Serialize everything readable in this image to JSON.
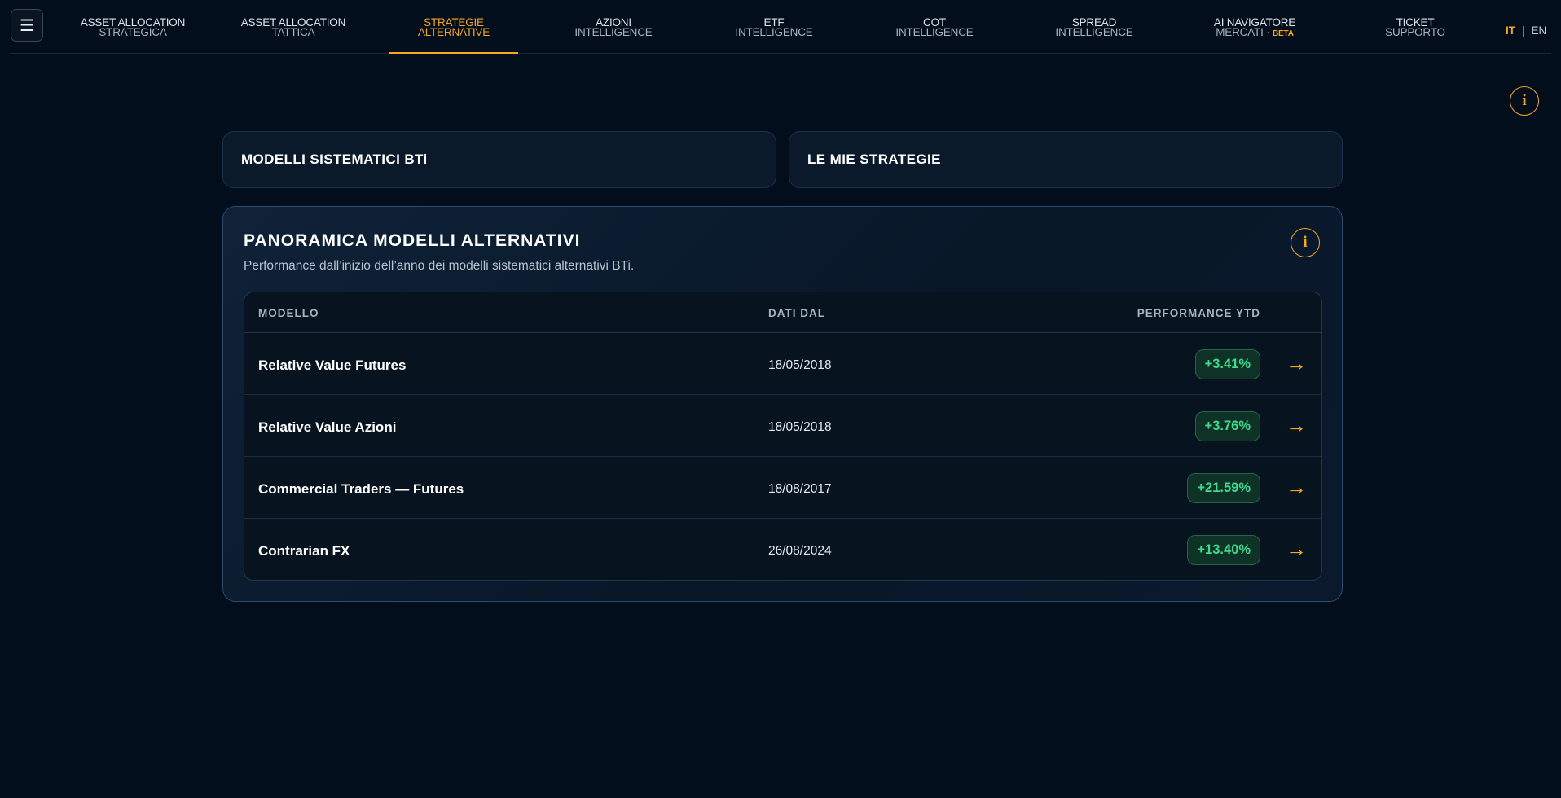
{
  "nav": {
    "menu_icon": "hamburger-icon",
    "items": [
      {
        "line1": "ASSET ALLOCATION",
        "line2": "STRATEGICA"
      },
      {
        "line1": "ASSET ALLOCATION",
        "line2": "TATTICA"
      },
      {
        "line1": "STRATEGIE",
        "line2": "ALTERNATIVE",
        "active": true
      },
      {
        "line1": "AZIONI",
        "line2": "INTELLIGENCE"
      },
      {
        "line1": "ETF",
        "line2": "INTELLIGENCE"
      },
      {
        "line1": "COT",
        "line2": "INTELLIGENCE"
      },
      {
        "line1": "SPREAD",
        "line2": "INTELLIGENCE"
      },
      {
        "line1": "AI NAVIGATORE",
        "line2": "MERCATI",
        "badge": "BETA"
      },
      {
        "line1": "TICKET",
        "line2": "SUPPORTO"
      }
    ],
    "lang_it": "IT",
    "lang_sep": "|",
    "lang_en": "EN",
    "accent_color": "#f5a623"
  },
  "info_icon_glyph": "i",
  "tabs": {
    "systematic": "MODELLI SISTEMATICI BTi",
    "mine": "LE MIE STRATEGIE"
  },
  "overview": {
    "title": "PANORAMICA MODELLI ALTERNATIVI",
    "subtitle": "Performance dall’inizio dell’anno dei modelli sistematici alternativi BTi.",
    "headers": {
      "model": "MODELLO",
      "since": "DATI DAL",
      "perf": "PERFORMANCE YTD"
    },
    "arrow_glyph": "→",
    "rows": [
      {
        "model": "Relative Value Futures",
        "since": "18/05/2018",
        "perf": "+3.41%"
      },
      {
        "model": "Relative Value Azioni",
        "since": "18/05/2018",
        "perf": "+3.76%"
      },
      {
        "model": "Commercial Traders — Futures",
        "since": "18/08/2017",
        "perf": "+21.59%"
      },
      {
        "model": "Contrarian FX",
        "since": "26/08/2024",
        "perf": "+13.40%"
      }
    ],
    "positive_color": "#41d98e"
  }
}
